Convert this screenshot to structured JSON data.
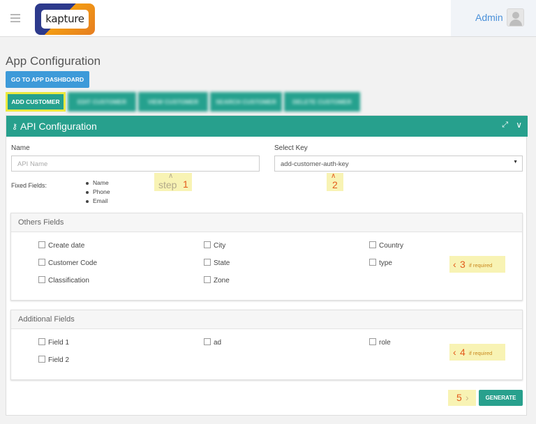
{
  "header": {
    "logo_text": "kapture",
    "admin_label": "Admin",
    "menu_icon": "hamburger-icon",
    "avatar_icon": "user-avatar-icon"
  },
  "page": {
    "title": "App Configuration",
    "dashboard_button": "GO TO APP DASHBOARD"
  },
  "tabs": [
    {
      "label": "ADD CUSTOMER"
    },
    {
      "label": "EDIT CUSTOMER"
    },
    {
      "label": "VIEW CUSTOMER"
    },
    {
      "label": "SEARCH CUSTOMER"
    },
    {
      "label": "DELETE CUSTOMER"
    }
  ],
  "panel": {
    "title": "API Configuration",
    "title_icon": "key-icon",
    "name_label": "Name",
    "name_placeholder": "API Name",
    "select_key_label": "Select Key",
    "select_key_value": "add-customer-auth-key",
    "fixed_fields_label": "Fixed Fields:",
    "fixed_fields": [
      "Name",
      "Phone",
      "Email"
    ],
    "others_title": "Others Fields",
    "others": [
      "Create date",
      "City",
      "Country",
      "Customer Code",
      "State",
      "type",
      "Classification",
      "Zone"
    ],
    "additional_title": "Additional Fields",
    "additional": [
      "Field 1",
      "ad",
      "role",
      "Field 2"
    ],
    "generate_button": "GENERATE"
  },
  "annotations": {
    "step1_word": "step",
    "step1_num": "1",
    "step2": "2",
    "step3_num": "3",
    "step3_note": "if required",
    "step4_num": "4",
    "step4_note": "if required",
    "step5": "5"
  },
  "colors": {
    "teal": "#27a08d",
    "blue_button": "#3d9ad9",
    "highlight_yellow": "#ece940",
    "note_bg": "#f8f3b4",
    "note_text": "#e35b1c"
  }
}
